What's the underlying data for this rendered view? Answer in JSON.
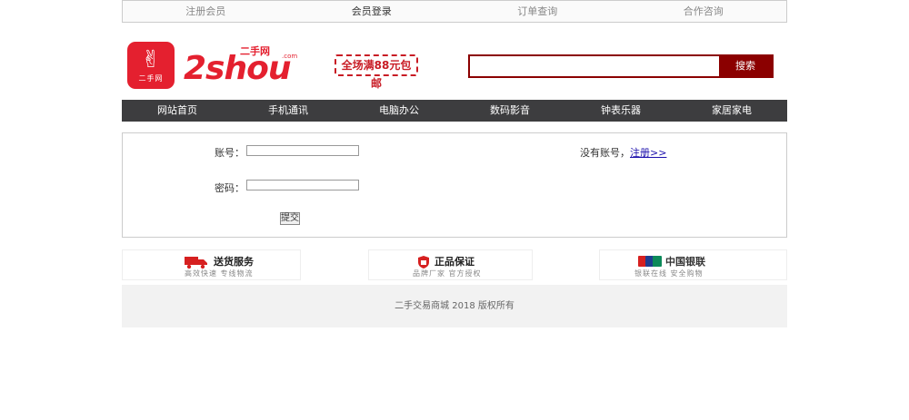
{
  "top_nav": {
    "items": [
      "注册会员",
      "会员登录",
      "订单查询",
      "合作咨询"
    ]
  },
  "header": {
    "logo_badge": "二手网",
    "logo_text": "2shou",
    "logo_cn": "二手网",
    "logo_com": ".com",
    "promo_stamp": "全场满88元包邮",
    "search": {
      "value": "",
      "placeholder": "",
      "button": "搜索"
    }
  },
  "main_nav": {
    "items": [
      "网站首页",
      "手机通讯",
      "电脑办公",
      "数码影音",
      "钟表乐器",
      "家居家电"
    ]
  },
  "login": {
    "account_label": "账号：",
    "password_label": "密码：",
    "submit_label": "提交",
    "no_account_text": "没有账号，",
    "register_link": "注册>>"
  },
  "services": [
    {
      "title": "送货服务",
      "subtitle": "高效快速 专线物流",
      "icon": "truck-icon"
    },
    {
      "title": "正品保证",
      "subtitle": "品牌厂家 官方授权",
      "icon": "shield-icon"
    },
    {
      "title": "中国银联",
      "subtitle": "银联在线 安全购物",
      "icon": "unionpay-icon"
    }
  ],
  "footer": {
    "text": "二手交易商城 2018 版权所有"
  },
  "colors": {
    "brand_red": "#e4202f",
    "search_dark_red": "#8b0000",
    "nav_dark": "#3d3d3f"
  }
}
